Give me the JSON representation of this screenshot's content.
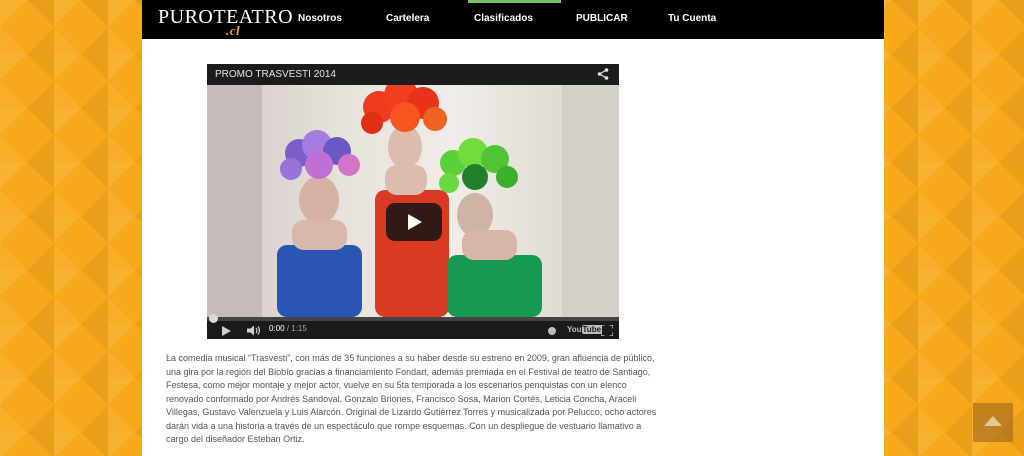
{
  "logo": {
    "main": "PUROTEATRO",
    "sub": ".cl"
  },
  "nav": {
    "items": [
      {
        "label": "Nosotros"
      },
      {
        "label": "Cartelera"
      },
      {
        "label": "Clasificados"
      },
      {
        "label": "PUBLICAR"
      },
      {
        "label": "Tu Cuenta"
      }
    ],
    "active": "Clasificados",
    "active_color": "#7ec36b"
  },
  "video": {
    "title": "PROMO TRASVESTI 2014",
    "current_time": "0:00",
    "separator": " / ",
    "duration": "1:15",
    "youtube_label": "You",
    "youtube_badge": "Tube",
    "progress": 0
  },
  "article": {
    "body": "La comedia musical “Trasvesti”, con más de 35 funciones a su haber desde su estreno en 2009, gran afluencia de público, una gira por la región del Biobío gracias a financiamiento Fondart, además premiada en el Festival de teatro de Santiago, Festesa, como mejor montaje y mejor actor, vuelve en su 5ta temporada a los escenarios penquistas con un elenco renovado conformado por Andrés Sandoval, Gonzalo Briones, Francisco Sosa, Marion Cortés, Leticia Concha, Araceli Villegas, Gustavo Valenzuela y Luis Alarcón. Original de Lizardo Gutiérrez Torres y musicalizada por Pelucco, ocho actores darán vida a una historia a través de un espectáculo que rompe esquemas. Con un despliegue de vestuario llamativo a cargo del diseñador Esteban Ortiz."
  },
  "colors": {
    "background": "#f7a91b",
    "navbar": "#000000",
    "text": "#555555"
  },
  "icons": [
    "share-icon",
    "play-icon",
    "volume-icon",
    "settings-icon",
    "youtube-logo",
    "fullscreen-icon",
    "arrow-up-icon"
  ]
}
